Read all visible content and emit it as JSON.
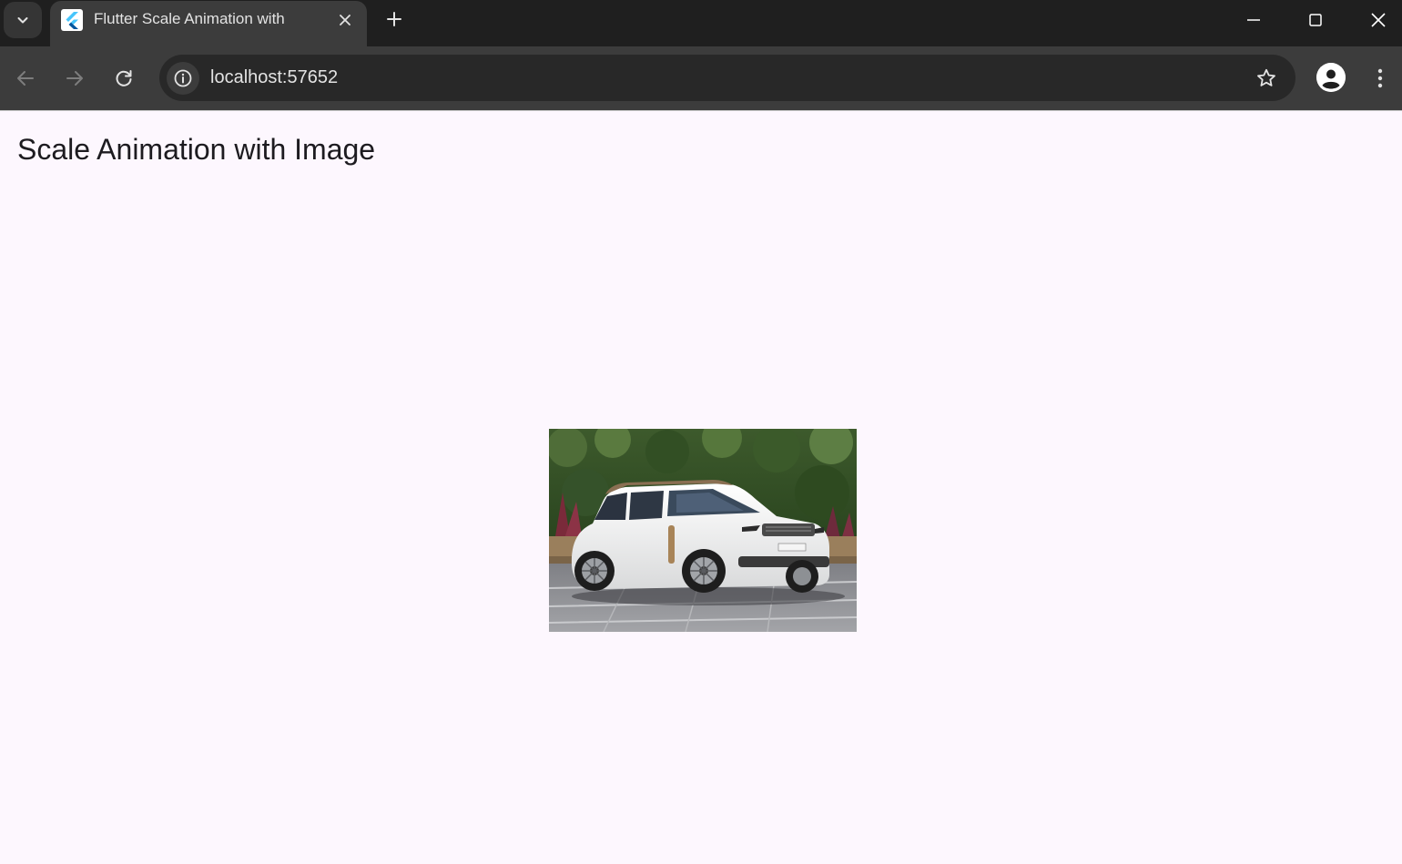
{
  "browser": {
    "tab": {
      "title": "Flutter Scale Animation with",
      "favicon_icon": "flutter-logo-icon",
      "close_icon": "close-icon"
    },
    "new_tab_icon": "plus-icon",
    "tab_search_icon": "chevron-down-icon",
    "window_controls": [
      "minimize-icon",
      "maximize-icon",
      "close-icon"
    ],
    "nav": {
      "back_icon": "arrow-left-icon",
      "forward_icon": "arrow-right-icon",
      "reload_icon": "reload-icon"
    },
    "address_bar": {
      "url": "localhost:57652",
      "site_info_icon": "info-icon",
      "bookmark_icon": "star-icon"
    },
    "profile_icon": "person-icon",
    "menu_icon": "kebab-menu-icon"
  },
  "app": {
    "title": "Scale Animation with Image",
    "image": {
      "subject": "car-photo",
      "colors": {
        "foliage": "#2f4a22",
        "car_body": "#f2f2f0",
        "ground": "#8d8e92"
      }
    }
  },
  "colors": {
    "tabstrip": "#1f1f1f",
    "toolbar": "#3c3c3c",
    "omnibox": "#282828",
    "page_background": "#fdf7fe",
    "title_text": "#1d1b20"
  }
}
